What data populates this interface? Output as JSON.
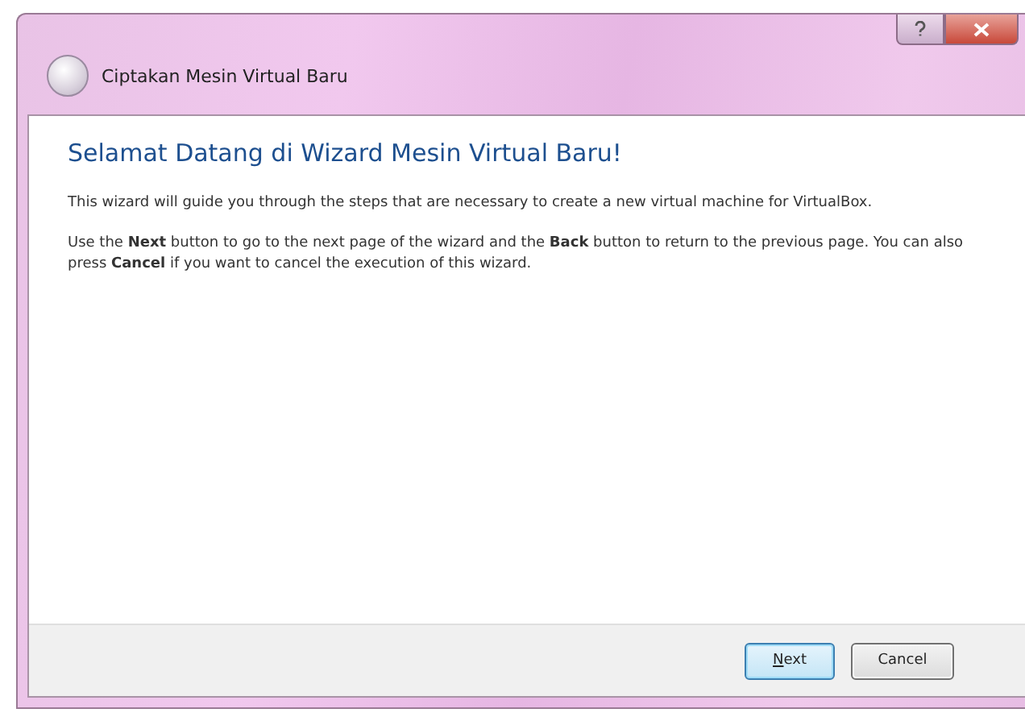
{
  "window": {
    "title": "Ciptakan Mesin Virtual Baru"
  },
  "page": {
    "heading": "Selamat Datang di Wizard Mesin Virtual Baru!",
    "paragraphs": [
      "This wizard will guide you through the steps that are necessary to create a new virtual machine for VirtualBox.",
      "Use the **Next** button to go to the next page of the wizard and the **Back** button to return to the previous page. You can also press **Cancel** if you want to cancel the execution of this wizard."
    ]
  },
  "buttons": [
    {
      "label": "Next",
      "kind": "default"
    },
    {
      "label": "Cancel",
      "kind": "normal"
    }
  ]
}
